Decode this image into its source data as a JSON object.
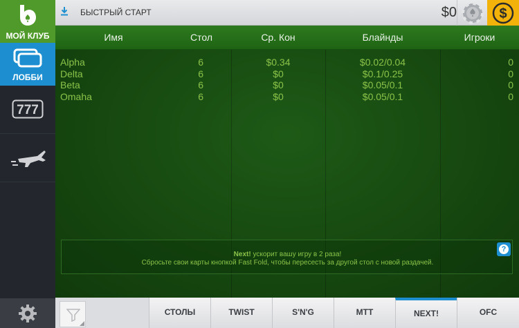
{
  "sidebar": {
    "club_label": "МОЙ КЛУБ",
    "lobby_label": "ЛОББИ",
    "icons": [
      "club-logo-icon",
      "lobby-cards-icon",
      "slots-777-icon",
      "airplane-icon",
      "gear-icon"
    ]
  },
  "topbar": {
    "quick_start_label": "БЫСТРЫЙ СТАРТ",
    "balance": "$0"
  },
  "table": {
    "headers": {
      "name": "Имя",
      "table": "Стол",
      "avg_pot": "Ср. Кон",
      "blinds": "Блайнды",
      "players": "Игроки"
    },
    "rows": [
      {
        "name": "Alpha",
        "table": "6",
        "avg_pot": "$0.34",
        "blinds": "$0.02/0.04",
        "players": "0"
      },
      {
        "name": "Delta",
        "table": "6",
        "avg_pot": "$0",
        "blinds": "$0.1/0.25",
        "players": "0"
      },
      {
        "name": "Beta",
        "table": "6",
        "avg_pot": "$0",
        "blinds": "$0.05/0.1",
        "players": "0"
      },
      {
        "name": "Omaha",
        "table": "6",
        "avg_pot": "$0",
        "blinds": "$0.05/0.1",
        "players": "0"
      }
    ]
  },
  "info": {
    "title_bold": "Next!",
    "title_rest": " ускорит вашу игру в 2 раза!",
    "text": "Сбросьте свои карты кнопкой Fast Fold, чтобы пересесть за другой стол с новой раздачей.",
    "help": "?"
  },
  "bottom": {
    "tabs": [
      {
        "label": "СТОЛЫ",
        "active": false
      },
      {
        "label": "TWIST",
        "active": false
      },
      {
        "label": "S'N'G",
        "active": false
      },
      {
        "label": "MTT",
        "active": false
      },
      {
        "label": "NEXT!",
        "active": true
      },
      {
        "label": "OFC",
        "active": false
      }
    ]
  },
  "colors": {
    "accent_blue": "#1d8fd0",
    "club_green": "#4f9a2a",
    "row_text": "#8bc34a",
    "dollar_yellow": "#f2b20a"
  }
}
